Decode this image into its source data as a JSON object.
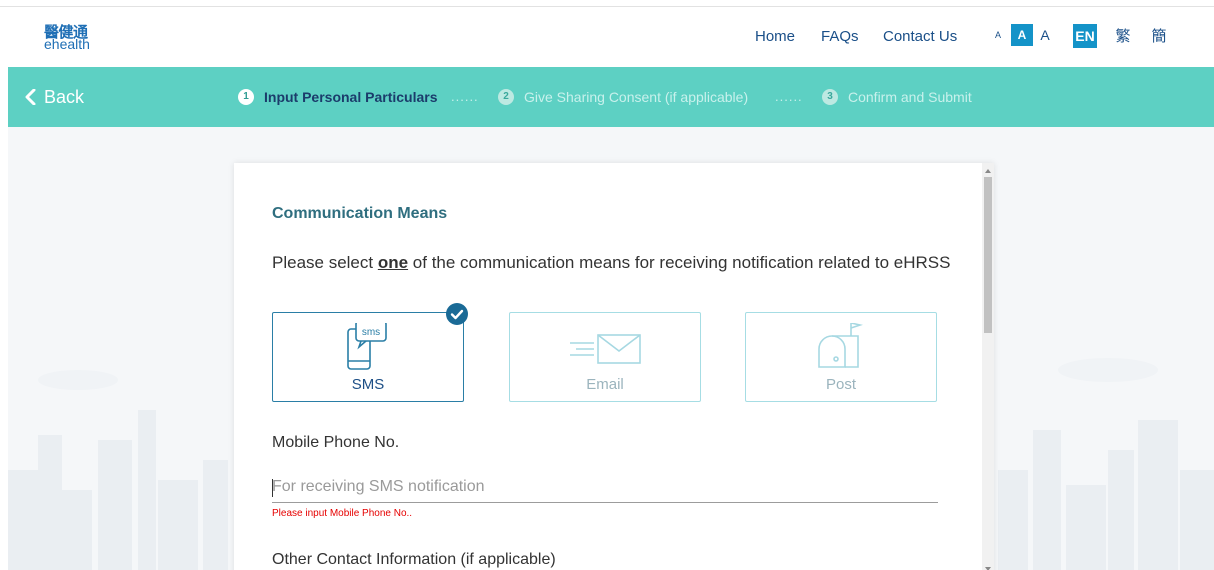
{
  "header": {
    "logo_cn": "醫健通",
    "logo_en": "ehealth",
    "nav": {
      "home": "Home",
      "faqs": "FAQs",
      "contact": "Contact Us"
    },
    "font_size": {
      "small": "A",
      "medium": "A",
      "large": "A",
      "selected": "medium"
    },
    "lang": {
      "en": "EN",
      "tc": "繁",
      "sc": "簡",
      "selected": "en"
    }
  },
  "stepbar": {
    "back_label": "Back",
    "steps": [
      {
        "num": "1",
        "label": "Input Personal Particulars",
        "active": true
      },
      {
        "num": "2",
        "label": "Give Sharing Consent (if applicable)",
        "active": false
      },
      {
        "num": "3",
        "label": "Confirm and Submit",
        "active": false
      }
    ],
    "separator": "......"
  },
  "form": {
    "section_title": "Communication Means",
    "instruction_pre": "Please select ",
    "instruction_em": "one",
    "instruction_post": " of the communication means for receiving notification related to eHRSS",
    "options": [
      {
        "label": "SMS",
        "icon": "sms-phone-icon",
        "selected": true
      },
      {
        "label": "Email",
        "icon": "email-envelope-icon",
        "selected": false
      },
      {
        "label": "Post",
        "icon": "mailbox-icon",
        "selected": false
      }
    ],
    "mobile_label": "Mobile Phone No.",
    "mobile_placeholder": "For receiving SMS notification",
    "mobile_value": "",
    "mobile_error": "Please input Mobile Phone No..",
    "other_contact_label": "Other Contact Information (if applicable)"
  },
  "colors": {
    "stepbar_bg": "#5dd0c3",
    "accent_blue": "#1493c8",
    "nav_text": "#1a4f88",
    "section_title": "#2f6e7f",
    "error": "#e60000"
  }
}
